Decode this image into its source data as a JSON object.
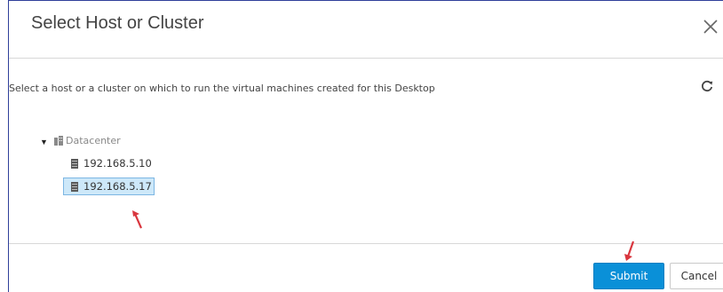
{
  "dialog": {
    "title": "Select Host or Cluster",
    "description": "Select a host or a cluster on which to run the virtual machines created for this Desktop",
    "close_icon": "close-icon",
    "refresh_icon": "refresh-icon"
  },
  "tree": {
    "root": {
      "label": "Datacenter",
      "icon": "datacenter-icon",
      "expanded": true,
      "children": [
        {
          "label": "192.168.5.10",
          "icon": "server-icon",
          "selected": false
        },
        {
          "label": "192.168.5.17",
          "icon": "server-icon",
          "selected": true
        }
      ]
    }
  },
  "footer": {
    "submit_label": "Submit",
    "cancel_label": "Cancel"
  },
  "colors": {
    "accent": "#0a90d8",
    "selection_bg": "#cde8f9",
    "annotation_arrow": "#d9363e"
  }
}
